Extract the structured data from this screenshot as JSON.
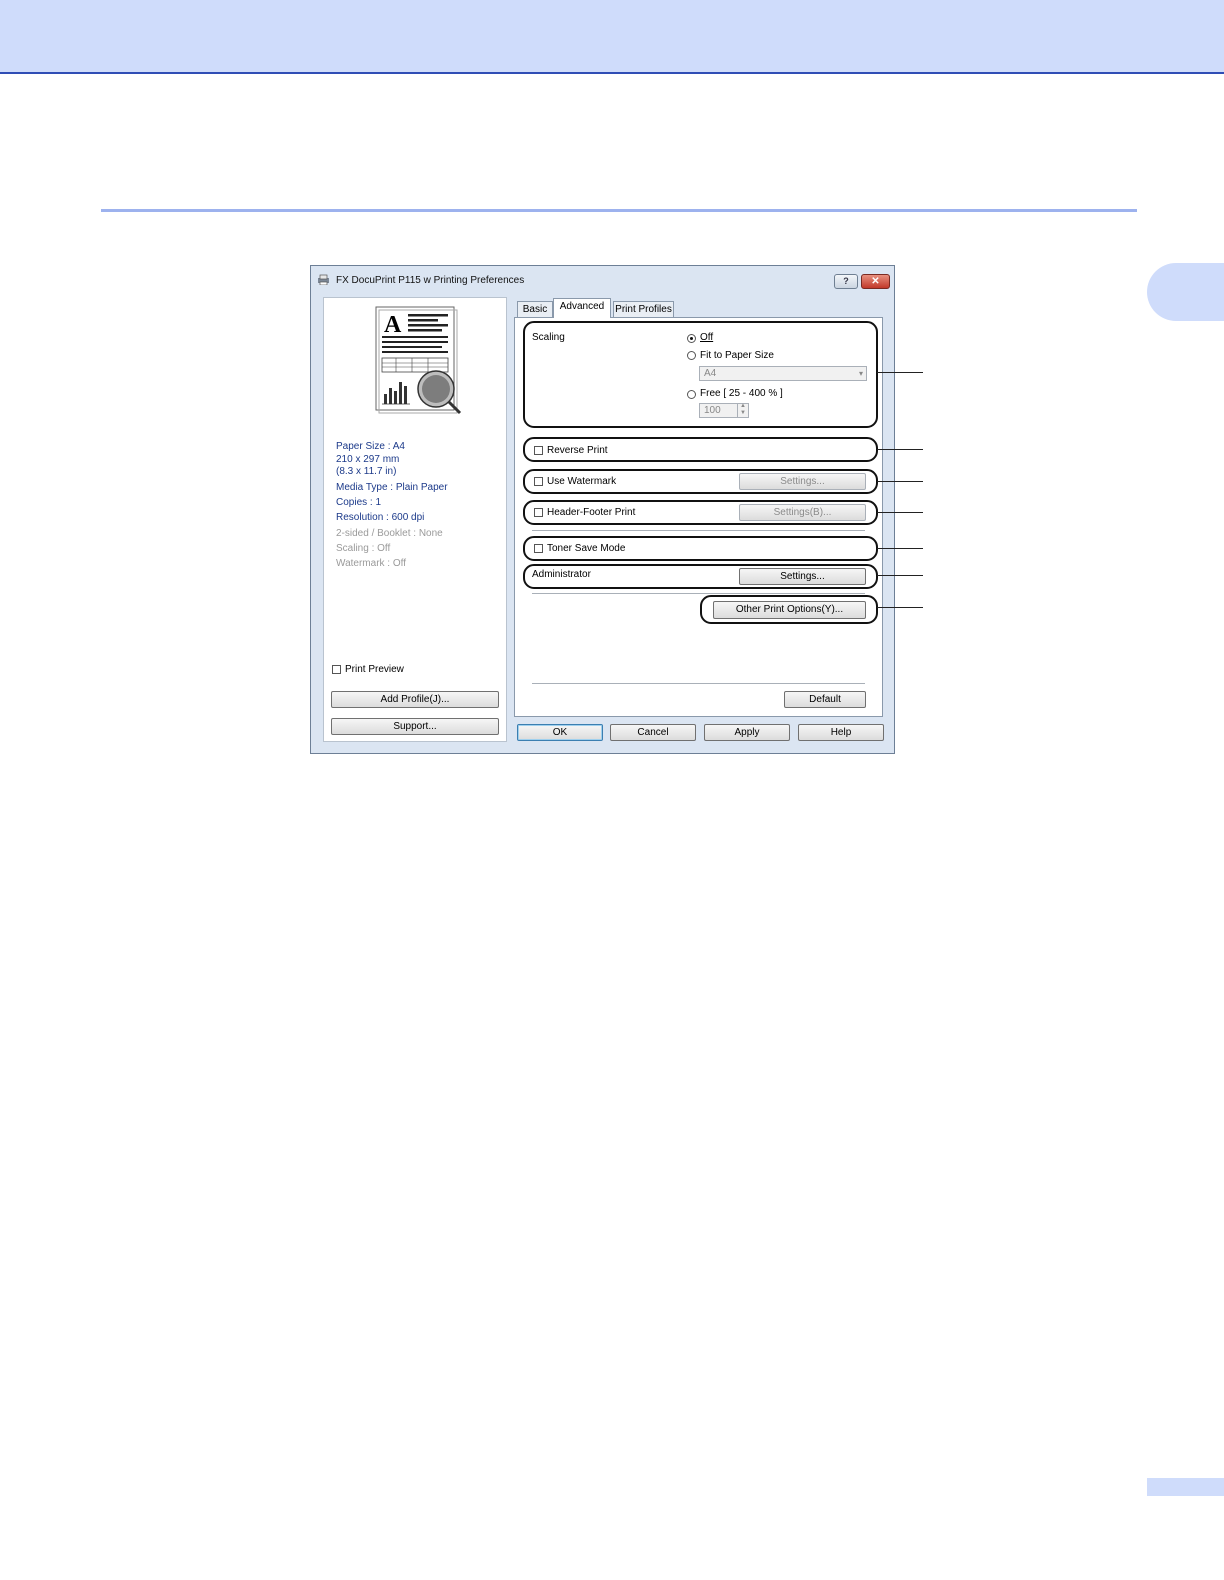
{
  "dialog": {
    "title": "FX DocuPrint P115 w Printing Preferences",
    "help_glyph": "?",
    "close_glyph": "✕"
  },
  "left_pane": {
    "info": [
      "Paper Size : A4",
      "210 x 297 mm",
      "(8.3 x 11.7 in)",
      "Media Type : Plain Paper",
      "Copies : 1",
      "Resolution : 600 dpi",
      "2-sided / Booklet : None",
      "Scaling : Off",
      "Watermark : Off"
    ],
    "print_preview_label": "Print Preview",
    "add_profile_label": "Add Profile(J)...",
    "support_label": "Support..."
  },
  "tabs": [
    "Basic",
    "Advanced",
    "Print Profiles"
  ],
  "advanced": {
    "scaling_label": "Scaling",
    "scaling_off": "Off",
    "scaling_fit": "Fit to Paper Size",
    "paper_size_value": "A4",
    "scaling_free": "Free [ 25 - 400 % ]",
    "free_value": "100",
    "reverse_print": "Reverse Print",
    "use_watermark": "Use Watermark",
    "watermark_settings": "Settings...",
    "header_footer": "Header-Footer Print",
    "header_footer_settings": "Settings(B)...",
    "toner_save": "Toner Save Mode",
    "administrator": "Administrator",
    "admin_settings": "Settings...",
    "other_print_options": "Other Print Options(Y)...",
    "default": "Default"
  },
  "footer_buttons": {
    "ok": "OK",
    "cancel": "Cancel",
    "apply": "Apply",
    "help": "Help"
  }
}
